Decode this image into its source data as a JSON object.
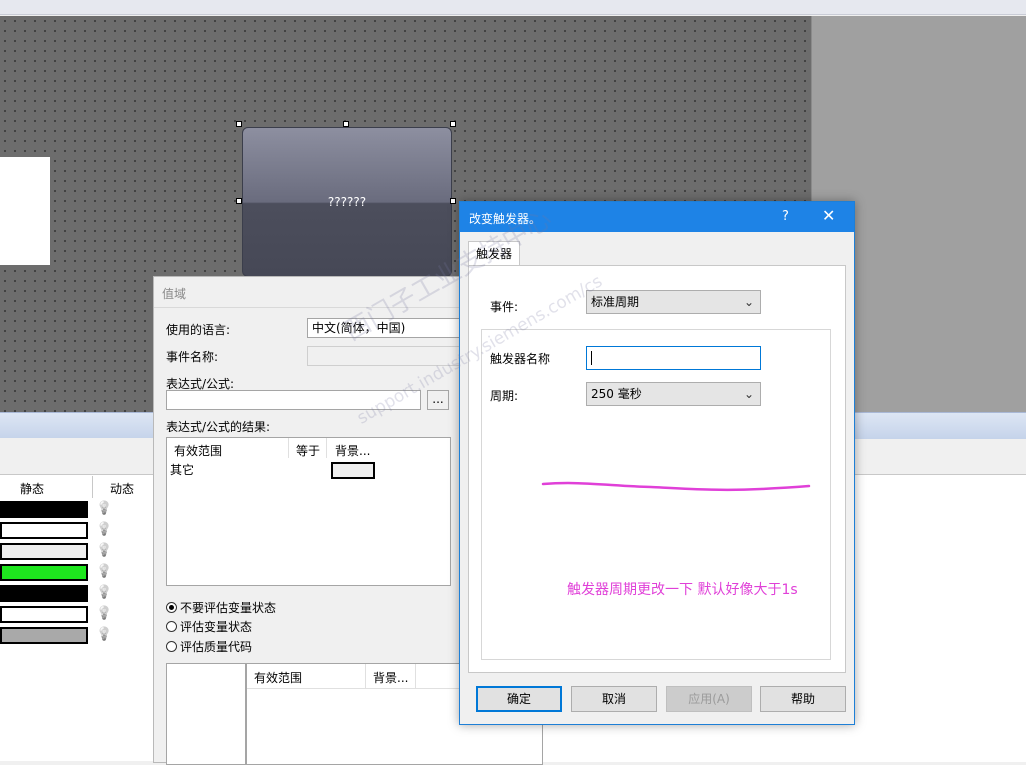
{
  "hmi": {
    "button_text": "??????"
  },
  "lower_panel": {
    "col_static": "静态",
    "col_dynamic": "动态",
    "swatches": [
      "#000000",
      "#ffffff",
      "#eeeeee",
      "#1ee61e",
      "#000000",
      "#ffffff",
      "#a9a9a9"
    ]
  },
  "range_dialog": {
    "title": "值域",
    "language_label": "使用的语言:",
    "language_value": "中文(简体，中国)",
    "event_name_label": "事件名称:",
    "expression_label": "表达式/公式:",
    "dots_label": "...",
    "result_label": "表达式/公式的结果:",
    "result_headers": [
      "有效范围",
      "等于",
      "背景..."
    ],
    "result_row": "其它",
    "options": [
      "不要评估变量状态",
      "评估变量状态",
      "评估质量代码"
    ],
    "list_headers": [
      "有效范围",
      "背景..."
    ]
  },
  "trigger_dialog": {
    "title": "改变触发器。",
    "help_label": "?",
    "close_label": "✕",
    "tab_label": "触发器",
    "event_label": "事件:",
    "event_value": "标准周期",
    "trigger_name_label": "触发器名称",
    "trigger_name_value": "",
    "period_label": "周期:",
    "period_value": "250 毫秒",
    "annotation": "触发器周期更改一下 默认好像大于1s",
    "annotation_color": "#e040d8",
    "ok_label": "确定",
    "cancel_label": "取消",
    "apply_label": "应用(A)",
    "help_button_label": "帮助"
  },
  "watermark": {
    "line1": "西门子工业支持中心",
    "line2": "support.industry.siemens.com/cs"
  }
}
